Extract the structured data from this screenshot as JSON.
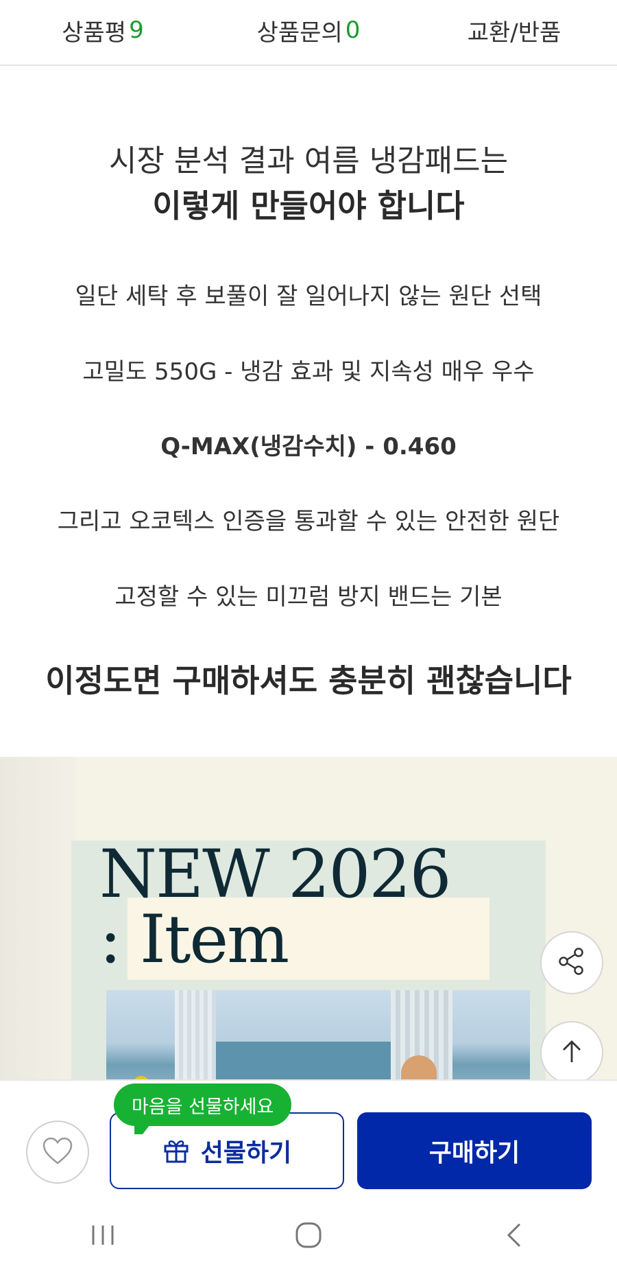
{
  "tabs": [
    {
      "label": "상품평",
      "count": "9"
    },
    {
      "label": "상품문의",
      "count": "0"
    },
    {
      "label": "교환/반품",
      "count": ""
    }
  ],
  "article": {
    "headline_line1": "시장 분석 결과 여름 냉감패드는",
    "headline_line2": "이렇게 만들어야 합니다",
    "lines": [
      "일단 세탁 후 보풀이 잘 일어나지 않는 원단 선택",
      "고밀도 550G - 냉감 효과 및 지속성 매우 우수",
      "Q-MAX(냉감수치) - 0.460",
      "그리고 오코텍스 인증을 통과할 수 있는 안전한 원단",
      "고정할 수 있는 미끄럼 방지 밴드는 기본"
    ],
    "closing": "이정도면 구매하셔도 충분히 괜찮습니다"
  },
  "banner": {
    "title_line1": "NEW 2026",
    "title_line2": ": Item"
  },
  "floating": {
    "share_icon": "share-icon",
    "scroll_top_icon": "arrow-up-icon"
  },
  "actions": {
    "tooltip": "마음을 선물하세요",
    "gift_label": "선물하기",
    "buy_label": "구매하기",
    "accent_color": "#0028a8",
    "tooltip_color": "#17b233"
  },
  "system_nav": [
    "recent-apps-icon",
    "home-icon",
    "back-icon"
  ]
}
